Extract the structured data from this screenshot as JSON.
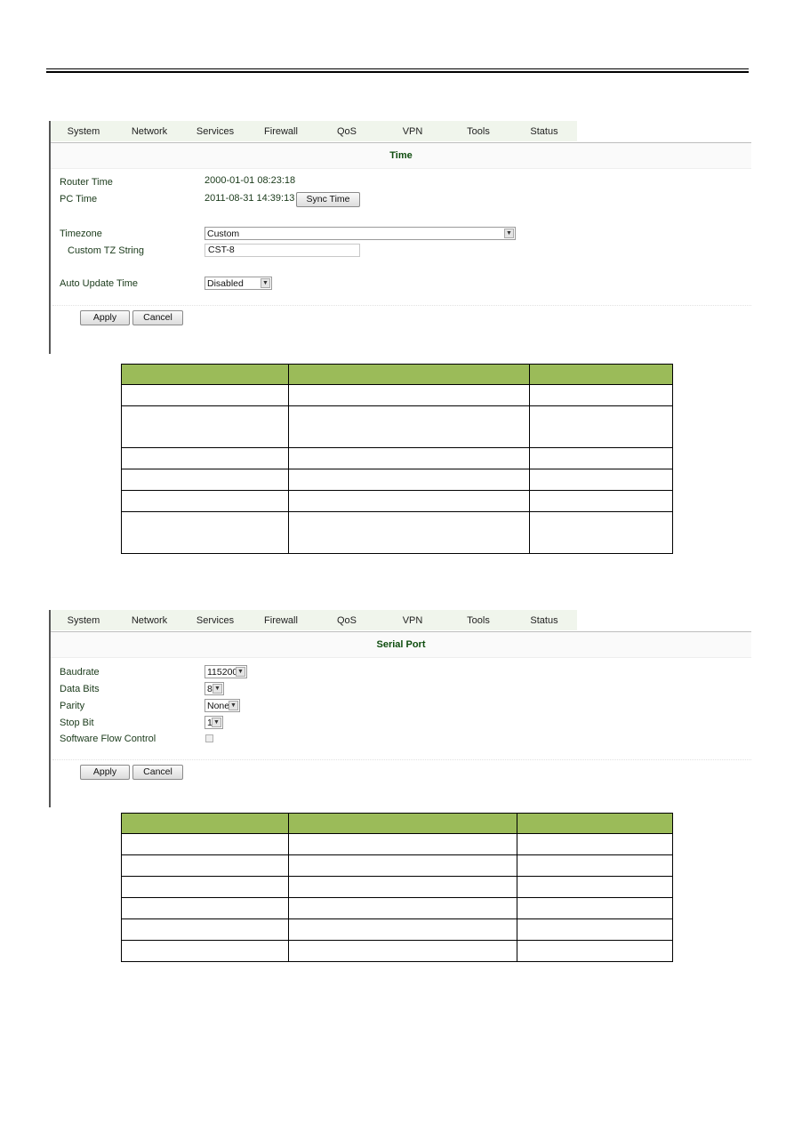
{
  "nav": {
    "items": [
      "System",
      "Network",
      "Services",
      "Firewall",
      "QoS",
      "VPN",
      "Tools",
      "Status"
    ]
  },
  "time_panel": {
    "title": "Time",
    "router_time_label": "Router Time",
    "router_time_value": "2000-01-01 08:23:18",
    "pc_time_label": "PC Time",
    "pc_time_value": "2011-08-31 14:39:13",
    "sync_button": "Sync Time",
    "timezone_label": "Timezone",
    "timezone_value": "Custom",
    "custom_tz_label": "Custom TZ String",
    "custom_tz_value": "CST-8",
    "auto_update_label": "Auto Update Time",
    "auto_update_value": "Disabled",
    "apply": "Apply",
    "cancel": "Cancel"
  },
  "serial_panel": {
    "title": "Serial Port",
    "baudrate_label": "Baudrate",
    "baudrate_value": "115200",
    "data_bits_label": "Data Bits",
    "data_bits_value": "8",
    "parity_label": "Parity",
    "parity_value": "None",
    "stop_bit_label": "Stop Bit",
    "stop_bit_value": "1",
    "flow_control_label": "Software Flow Control",
    "flow_control_checked": false,
    "apply": "Apply",
    "cancel": "Cancel"
  },
  "colors": {
    "table_header": "#9bbb59",
    "nav_bg": "#f0f5ec",
    "title_text": "#0f4d0f"
  },
  "icons": {
    "dropdown_arrow": "▼"
  }
}
